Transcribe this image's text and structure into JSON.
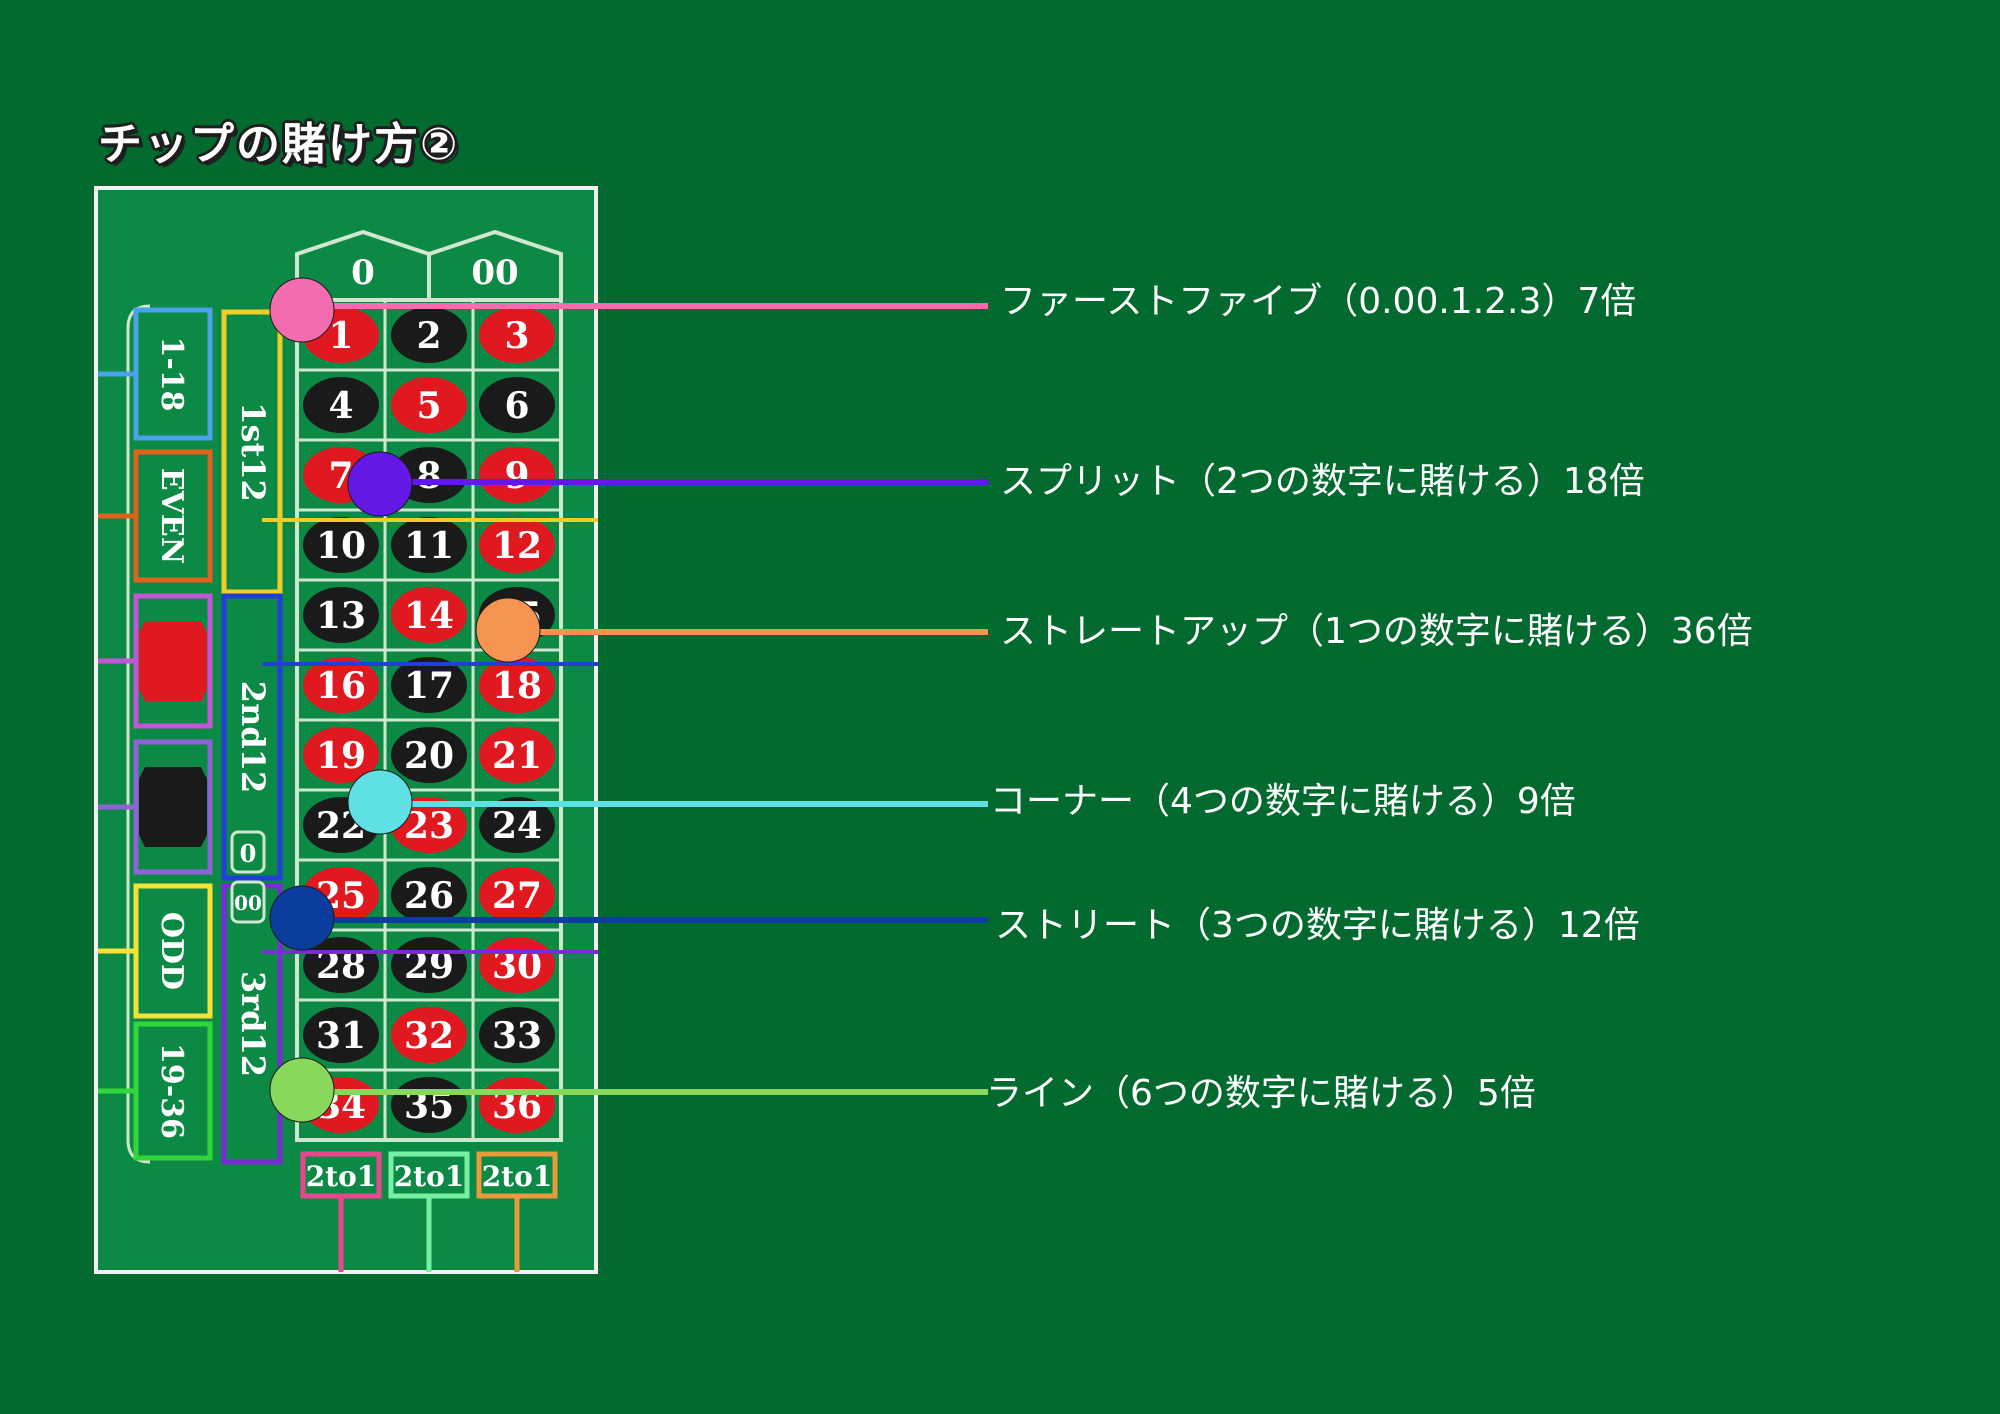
{
  "title": "チップの賭け方②",
  "board": {
    "zeros": [
      "0",
      "00"
    ],
    "numbers": [
      {
        "n": "1",
        "c": "red"
      },
      {
        "n": "2",
        "c": "black"
      },
      {
        "n": "3",
        "c": "red"
      },
      {
        "n": "4",
        "c": "black"
      },
      {
        "n": "5",
        "c": "red"
      },
      {
        "n": "6",
        "c": "black"
      },
      {
        "n": "7",
        "c": "red"
      },
      {
        "n": "8",
        "c": "black"
      },
      {
        "n": "9",
        "c": "red"
      },
      {
        "n": "10",
        "c": "black"
      },
      {
        "n": "11",
        "c": "black"
      },
      {
        "n": "12",
        "c": "red"
      },
      {
        "n": "13",
        "c": "black"
      },
      {
        "n": "14",
        "c": "red"
      },
      {
        "n": "15",
        "c": "black"
      },
      {
        "n": "16",
        "c": "red"
      },
      {
        "n": "17",
        "c": "black"
      },
      {
        "n": "18",
        "c": "red"
      },
      {
        "n": "19",
        "c": "red"
      },
      {
        "n": "20",
        "c": "black"
      },
      {
        "n": "21",
        "c": "red"
      },
      {
        "n": "22",
        "c": "black"
      },
      {
        "n": "23",
        "c": "red"
      },
      {
        "n": "24",
        "c": "black"
      },
      {
        "n": "25",
        "c": "red"
      },
      {
        "n": "26",
        "c": "black"
      },
      {
        "n": "27",
        "c": "red"
      },
      {
        "n": "28",
        "c": "black"
      },
      {
        "n": "29",
        "c": "black"
      },
      {
        "n": "30",
        "c": "red"
      },
      {
        "n": "31",
        "c": "black"
      },
      {
        "n": "32",
        "c": "red"
      },
      {
        "n": "33",
        "c": "black"
      },
      {
        "n": "34",
        "c": "red"
      },
      {
        "n": "35",
        "c": "black"
      },
      {
        "n": "36",
        "c": "red"
      }
    ],
    "dozens": [
      "1st12",
      "2nd12",
      "3rd12"
    ],
    "dozen_colors": [
      "#f2cd27",
      "#1f3fd6",
      "#7a2bd6"
    ],
    "side_bets": [
      {
        "label": "1-18",
        "color": "#4aa3e8",
        "kind": "text"
      },
      {
        "label": "EVEN",
        "color": "#e0601c",
        "kind": "text"
      },
      {
        "label": "",
        "color": "#c455d8",
        "kind": "red-diamond"
      },
      {
        "label": "",
        "color": "#8f62d8",
        "kind": "black-diamond"
      },
      {
        "label": "ODD",
        "color": "#f5e234",
        "kind": "text"
      },
      {
        "label": "19-36",
        "color": "#33d63a",
        "kind": "text"
      }
    ],
    "columns": [
      {
        "label": "2to1",
        "color": "#e8468e"
      },
      {
        "label": "2to1",
        "color": "#76f0a2"
      },
      {
        "label": "2to1",
        "color": "#e89a3c"
      }
    ],
    "mid_zero": "0",
    "mid_double_zero": "00",
    "colors": {
      "red": "#e01820",
      "black": "#1a1a1a",
      "felt": "#0c8a45",
      "line": "#cfe6cf"
    }
  },
  "bets": [
    {
      "label": "ファーストファイブ（0.00.1.2.3）7倍",
      "color": "#f46cb0"
    },
    {
      "label": "スプリット（2つの数字に賭ける）18倍",
      "color": "#6418e6"
    },
    {
      "label": "ストレートアップ（1つの数字に賭ける）36倍",
      "color": "#f59350"
    },
    {
      "label": "コーナー（4つの数字に賭ける）9倍",
      "color": "#5ee0e4"
    },
    {
      "label": "ストリート（3つの数字に賭ける）12倍",
      "color": "#0b3d9e"
    },
    {
      "label": "ライン（6つの数字に賭ける）5倍",
      "color": "#88d85c"
    }
  ]
}
